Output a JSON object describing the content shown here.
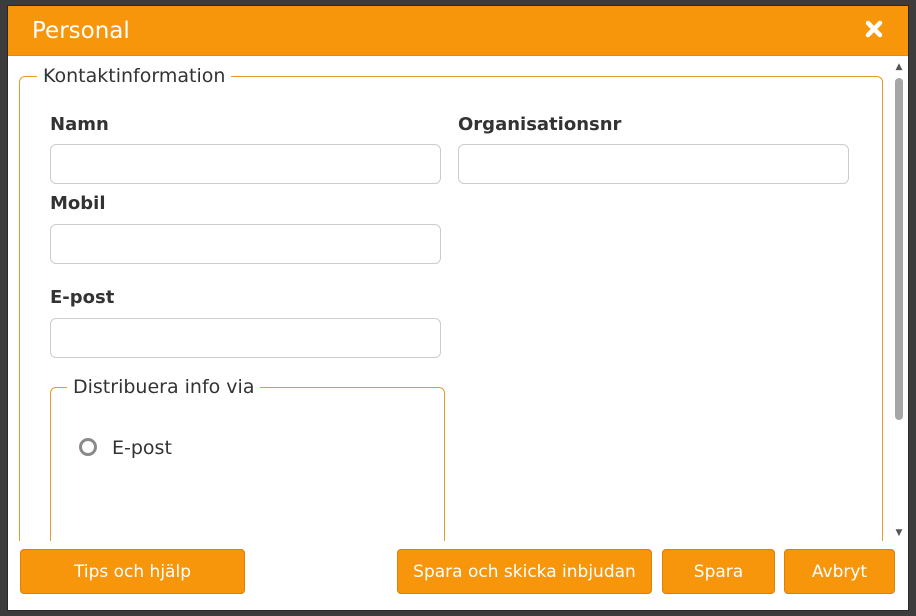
{
  "dialog": {
    "title": "Personal",
    "close_icon": "close-icon"
  },
  "kontakt": {
    "legend": "Kontaktinformation",
    "fields": {
      "namn": {
        "label": "Namn",
        "value": "",
        "placeholder": ""
      },
      "organisationsnr": {
        "label": "Organisationsnr",
        "value": "",
        "placeholder": ""
      },
      "mobil": {
        "label": "Mobil",
        "value": "",
        "placeholder": ""
      },
      "epost": {
        "label": "E-post",
        "value": "",
        "placeholder": ""
      }
    }
  },
  "distribuera": {
    "legend": "Distribuera info via",
    "options": [
      {
        "label": "E-post",
        "selected": false
      }
    ]
  },
  "footer": {
    "tips_label": "Tips och hjälp",
    "spara_skicka_label": "Spara och skicka inbjudan",
    "spara_label": "Spara",
    "avbryt_label": "Avbryt"
  },
  "colors": {
    "accent": "#f7960a",
    "border_accent": "#e39a2e"
  }
}
